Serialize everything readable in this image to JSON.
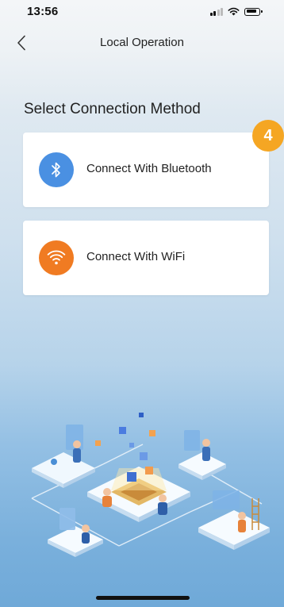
{
  "status_bar": {
    "time": "13:56",
    "icons": [
      "signal-icon",
      "wifi-icon",
      "battery-icon"
    ]
  },
  "nav": {
    "title": "Local Operation",
    "back_icon": "chevron-left-icon"
  },
  "section": {
    "title": "Select Connection Method"
  },
  "step_badge": "4",
  "options": [
    {
      "label": "Connect With Bluetooth",
      "icon": "bluetooth-icon",
      "icon_color": "#4a90e2"
    },
    {
      "label": "Connect With WiFi",
      "icon": "wifi-icon",
      "icon_color": "#f07b22"
    }
  ],
  "colors": {
    "accent_badge": "#f5a623",
    "background_top": "#f4f6f8",
    "background_bottom": "#6fa9d8"
  }
}
